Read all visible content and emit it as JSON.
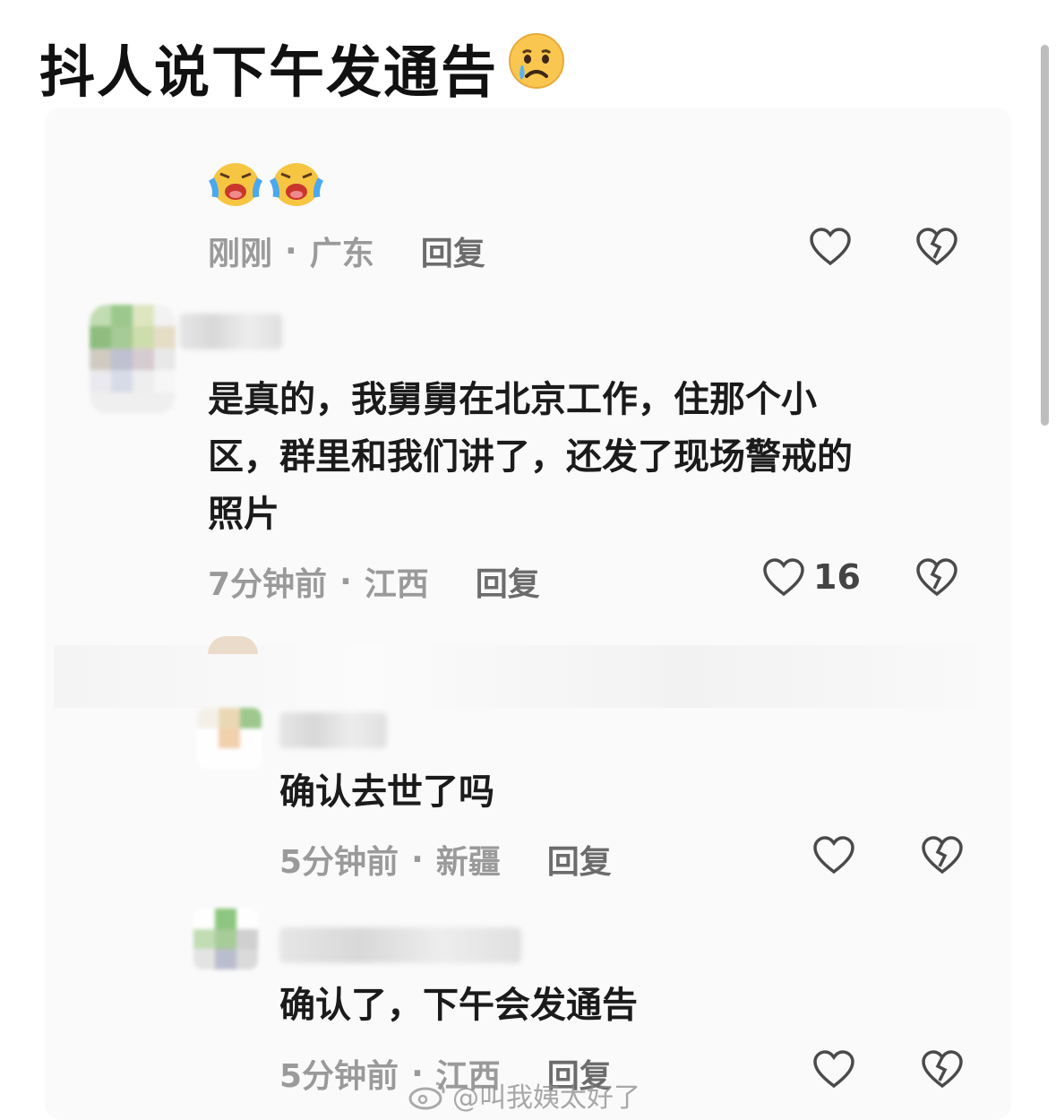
{
  "headline": {
    "text": "抖人说下午发通告",
    "emoji": "crying-face"
  },
  "comments": [
    {
      "text": "",
      "emoji_line": "loudly-crying-face ×2",
      "time": "刚刚",
      "location": "广东",
      "reply_label": "回复",
      "likes": ""
    },
    {
      "text_lines": [
        "是真的，我舅舅在北京工作，住那个小",
        "区，群里和我们讲了，还发了现场警戒的",
        "照片"
      ],
      "time": "7分钟前",
      "location": "江西",
      "reply_label": "回复",
      "likes": "16"
    },
    {
      "text": "确认去世了吗",
      "time": "5分钟前",
      "location": "新疆",
      "reply_label": "回复",
      "likes": ""
    },
    {
      "text": "确认了，下午会发通告",
      "time": "5分钟前",
      "location": "江西",
      "reply_label": "回复",
      "likes": ""
    }
  ],
  "separator": "·",
  "watermark": "@叫我姨太好了",
  "colors": {
    "like_outline": "#4a4a4a",
    "meta_gray": "#9a9a9a",
    "emoji_yellow": "#f7c948"
  }
}
